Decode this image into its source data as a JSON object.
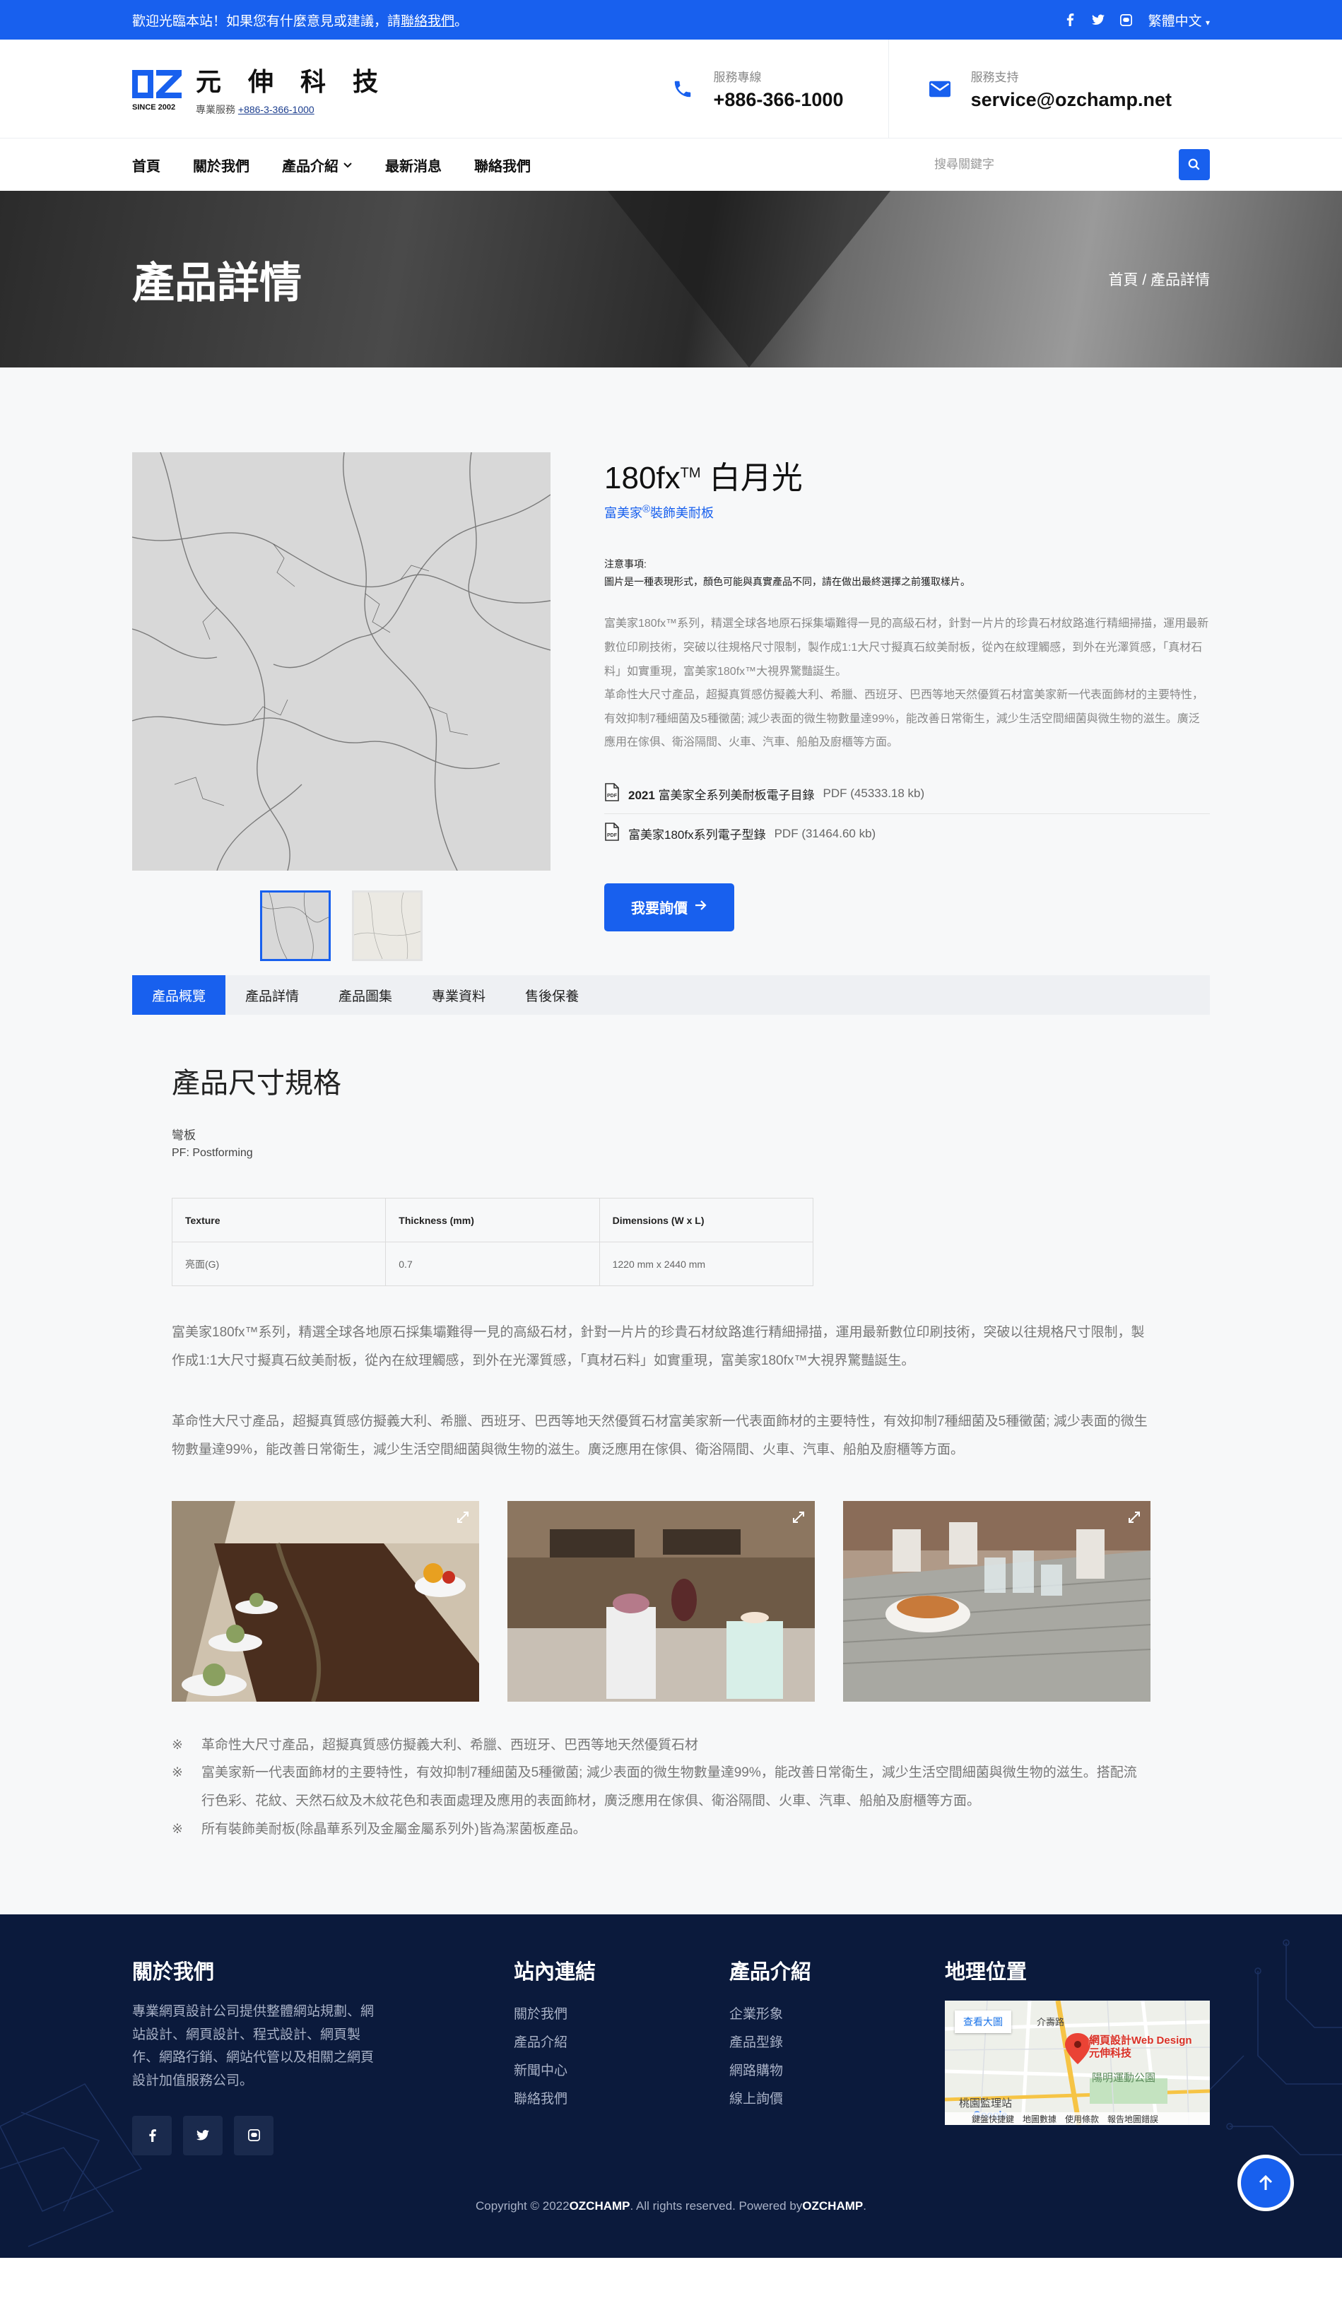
{
  "topbar": {
    "message_prefix": "歡迎光臨本站！如果您有什麼意見或建議，請",
    "message_link": "聯絡我們",
    "message_suffix": "。",
    "language": "繁體中文"
  },
  "header": {
    "logo_name": "元 伸 科 技",
    "logo_tag": "SINCE 2002",
    "logo_sub_label": "專業服務",
    "logo_sub_phone": "+886-3-366-1000",
    "hotline_label": "服務專線",
    "hotline_value": "+886-366-1000",
    "support_label": "服務支持",
    "support_value": "service@ozchamp.net"
  },
  "nav": {
    "items": [
      "首頁",
      "關於我們",
      "產品介紹",
      "最新消息",
      "聯絡我們"
    ],
    "search_placeholder": "搜尋關鍵字"
  },
  "banner": {
    "title": "產品詳情",
    "crumb_home": "首頁",
    "crumb_sep": "/",
    "crumb_current": "產品詳情"
  },
  "product": {
    "title": "180fx",
    "title_tm": "TM",
    "title_name": " 白月光",
    "brand": "富美家",
    "brand_reg": "®",
    "brand_suffix": "裝飾美耐板",
    "notice_title": "注意事項:",
    "notice_text": "圖片是一種表現形式，顏色可能與真實產品不同，請在做出最終選擇之前獲取樣片。",
    "desc1": "富美家180fx™系列，精選全球各地原石採集壩難得一見的高級石材，針對一片片的珍貴石材紋路進行精細掃描，運用最新數位印刷技術，突破以往規格尺寸限制，製作成1:1大尺寸擬真石紋美耐板，從內在紋理觸感，到外在光澤質感，「真材石料」如實重現，富美家180fx™大視界驚豔誕生。",
    "desc2": "革命性大尺寸產品，超擬真質感仿擬義大利、希臘、西班牙、巴西等地天然優質石材富美家新一代表面飾材的主要特性，有效抑制7種細菌及5種黴菌; 減少表面的微生物數量達99%，能改善日常衛生，減少生活空間細菌與微生物的滋生。廣泛應用在傢俱、衛浴隔間、火車、汽車、船舶及廚櫃等方面。",
    "files": [
      {
        "year": "2021 ",
        "name": "富美家全系列美耐板電子目錄",
        "size": "PDF (45333.18 kb)"
      },
      {
        "year": "",
        "name": "富美家180fx系列電子型錄",
        "size": "PDF (31464.60 kb)"
      }
    ],
    "inquiry_button": "我要詢價"
  },
  "tabs": [
    "產品概覽",
    "產品詳情",
    "產品圖集",
    "專業資料",
    "售後保養"
  ],
  "overview": {
    "heading": "產品尺寸規格",
    "sub1": "彎板",
    "sub2": "PF: Postforming",
    "table_headers": [
      "Texture",
      "Thickness (mm)",
      "Dimensions (W x L)"
    ],
    "table_rows": [
      [
        "亮面(G)",
        "0.7",
        "1220 mm x 2440 mm"
      ]
    ],
    "para1": "富美家180fx™系列，精選全球各地原石採集壩難得一見的高級石材，針對一片片的珍貴石材紋路進行精細掃描，運用最新數位印刷技術，突破以往規格尺寸限制，製作成1:1大尺寸擬真石紋美耐板，從內在紋理觸感，到外在光澤質感，「真材石料」如實重現，富美家180fx™大視界驚豔誕生。",
    "para2": "革命性大尺寸產品，超擬真質感仿擬義大利、希臘、西班牙、巴西等地天然優質石材富美家新一代表面飾材的主要特性，有效抑制7種細菌及5種黴菌; 減少表面的微生物數量達99%，能改善日常衛生，減少生活空間細菌與微生物的滋生。廣泛應用在傢俱、衛浴隔間、火車、汽車、船舶及廚櫃等方面。",
    "notes": [
      "革命性大尺寸產品，超擬真質感仿擬義大利、希臘、西班牙、巴西等地天然優質石材",
      "富美家新一代表面飾材的主要特性，有效抑制7種細菌及5種黴菌; 減少表面的微生物數量達99%，能改善日常衛生，減少生活空間細菌與微生物的滋生。搭配流行色彩、花紋、天然石紋及木紋花色和表面處理及應用的表面飾材，廣泛應用在傢俱、衛浴隔間、火車、汽車、船舶及廚櫃等方面。",
      "所有裝飾美耐板(除晶華系列及金屬金屬系列外)皆為潔菌板產品。"
    ]
  },
  "footer": {
    "about_title": "關於我們",
    "about_text": "專業網頁設計公司提供整體網站規劃、網站設計、網頁設計、程式設計、網頁製作、網路行銷、網站代管以及相關之網頁設計加值服務公司。",
    "links_title": "站內連結",
    "links": [
      "關於我們",
      "產品介紹",
      "新聞中心",
      "聯絡我們"
    ],
    "products_title": "產品介紹",
    "products": [
      "企業形象",
      "產品型錄",
      "網路購物",
      "線上詢價"
    ],
    "location_title": "地理位置",
    "map_view_button": "查看大圖",
    "map_pin_label": "網頁設計Web Design 元伸科技",
    "map_place_1": "陽明運動公園",
    "map_place_2": "桃園監理站",
    "map_place_3": "介壽路",
    "map_bottom": [
      "鍵盤快捷鍵",
      "地圖數據",
      "使用條款",
      "報告地圖錯誤"
    ],
    "copyright_prefix": "Copyright © 2022 ",
    "copyright_brand": "OZCHAMP",
    "copyright_mid": ". All rights reserved. Powered by",
    "copyright_brand2": "OZCHAMP",
    "copyright_end": "."
  }
}
